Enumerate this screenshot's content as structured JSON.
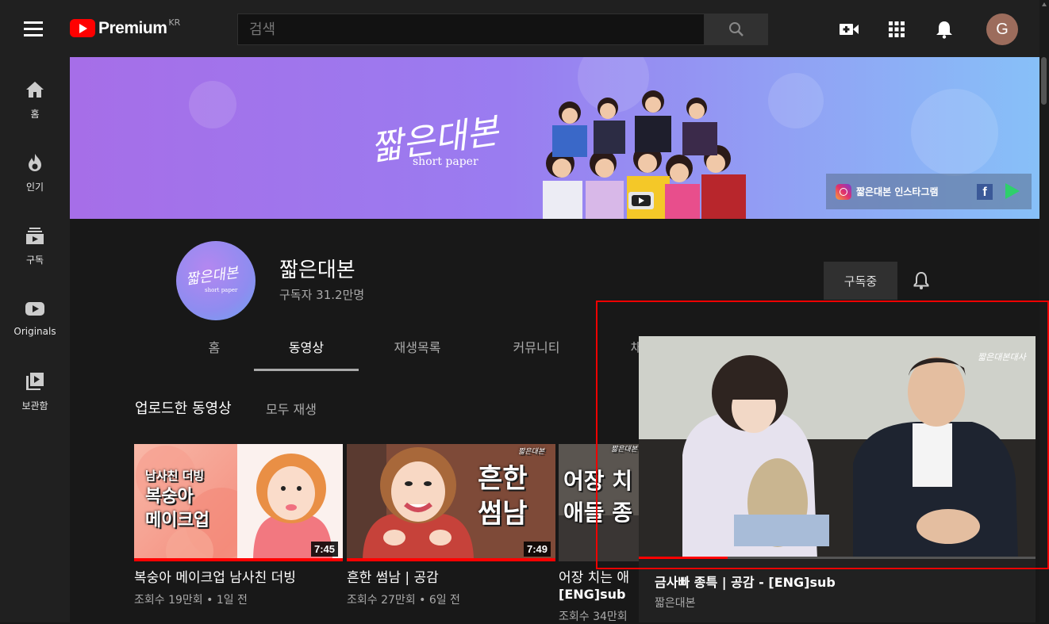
{
  "header": {
    "logo_text": "Premium",
    "logo_region": "KR",
    "search_placeholder": "검색",
    "avatar_letter": "G"
  },
  "sidebar": {
    "items": [
      {
        "label": "홈",
        "icon": "home-icon"
      },
      {
        "label": "인기",
        "icon": "trending-icon"
      },
      {
        "label": "구독",
        "icon": "subscriptions-icon"
      },
      {
        "label": "Originals",
        "icon": "originals-icon"
      },
      {
        "label": "보관함",
        "icon": "library-icon"
      }
    ]
  },
  "banner": {
    "title": "짧은대본",
    "subtitle": "short paper",
    "instagram_label": "짧은대본 인스타그램"
  },
  "channel": {
    "avatar_title": "짧은대본",
    "avatar_subtitle": "short paper",
    "name": "짧은대본",
    "subscribers": "구독자 31.2만명",
    "subscribe_label": "구독중",
    "tabs": [
      "홈",
      "동영상",
      "재생목록",
      "커뮤니티",
      "채"
    ],
    "active_tab": "동영상"
  },
  "section": {
    "title": "업로드한 동영상",
    "play_all": "모두 재생"
  },
  "videos": [
    {
      "title": "복숭아 메이크업 남사친 더빙",
      "meta": "조회수 19만회 • 1일 전",
      "duration": "7:45",
      "caption_lines": [
        "남사친 더빙",
        "복숭아",
        "메이크업"
      ],
      "watched": 1.0
    },
    {
      "title": "흔한 썸남 | 공감",
      "meta": "조회수 27만회 • 6일 전",
      "duration": "7:49",
      "caption_lines": [
        "흔한",
        "썸남"
      ],
      "watermark": "짧은대본",
      "watched": 1.0
    },
    {
      "title": "어장 치는 애",
      "title_line2": "[ENG]sub",
      "meta": "조회수 34만회",
      "caption_lines": [
        "어장 치",
        "애들 종"
      ],
      "watermark": "짧은대본"
    }
  ],
  "miniplayer": {
    "title": "금사빠 종특 | 공감 - [ENG]sub",
    "channel": "짧은대본",
    "watermark": "짧은대본대사",
    "progress": 0.224
  },
  "colors": {
    "accent": "#ff0000",
    "background": "#181818",
    "surface": "#202020",
    "highlight_outline": "#ee0000"
  }
}
